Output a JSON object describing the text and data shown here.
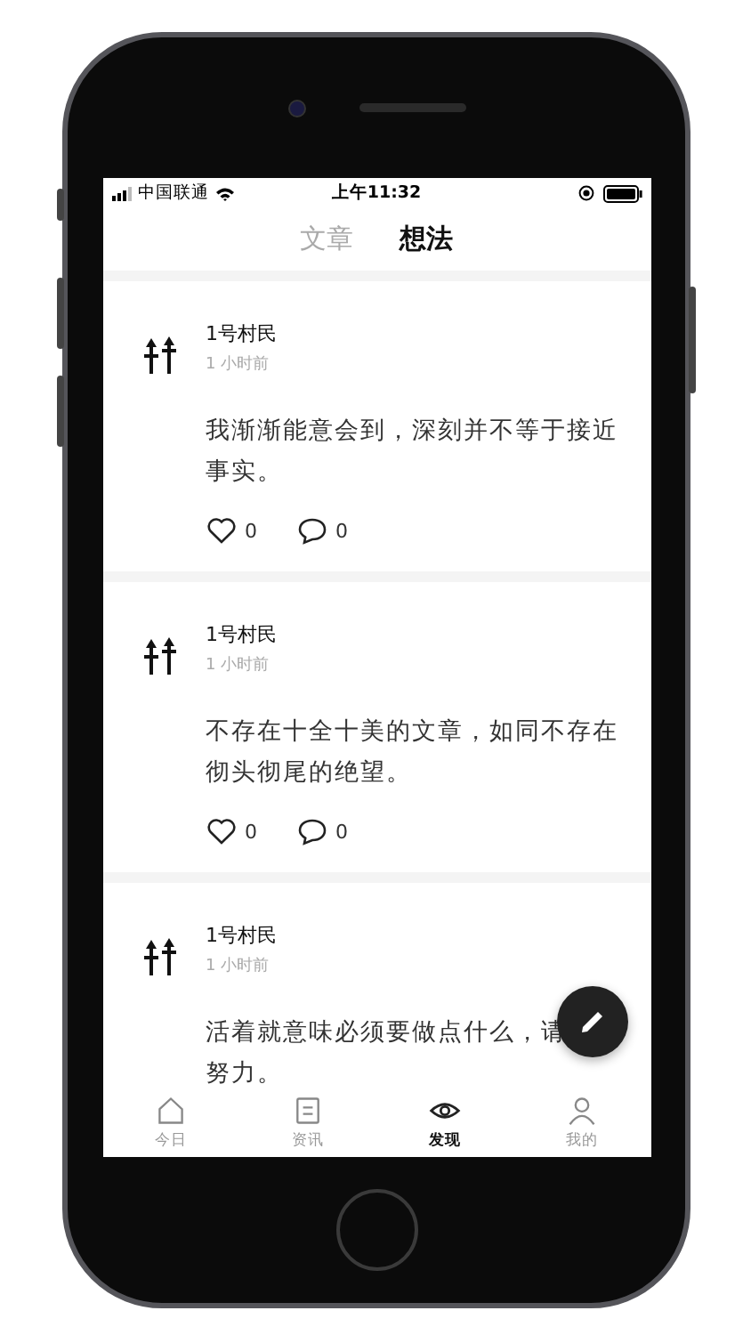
{
  "status_bar": {
    "carrier": "中国联通",
    "time": "上午11:32"
  },
  "tabs": [
    {
      "label": "文章",
      "selected": false
    },
    {
      "label": "想法",
      "selected": true
    }
  ],
  "posts": [
    {
      "author": "1号村民",
      "time": "1 小时前",
      "text": "我渐渐能意会到，深刻并不等于接近事实。",
      "likes": "0",
      "comments": "0"
    },
    {
      "author": "1号村民",
      "time": "1 小时前",
      "text": "不存在十全十美的文章，如同不存在彻头彻尾的绝望。",
      "likes": "0",
      "comments": "0"
    },
    {
      "author": "1号村民",
      "time": "1 小时前",
      "lines": [
        "活着就意味必须要做点什么，请",
        "努力。"
      ]
    }
  ],
  "bottom_tabs": [
    {
      "kind": "home",
      "label": "今日",
      "selected": false
    },
    {
      "kind": "news",
      "label": "资讯",
      "selected": false
    },
    {
      "kind": "discover",
      "label": "发现",
      "selected": true
    },
    {
      "kind": "profile",
      "label": "我的",
      "selected": false
    }
  ]
}
